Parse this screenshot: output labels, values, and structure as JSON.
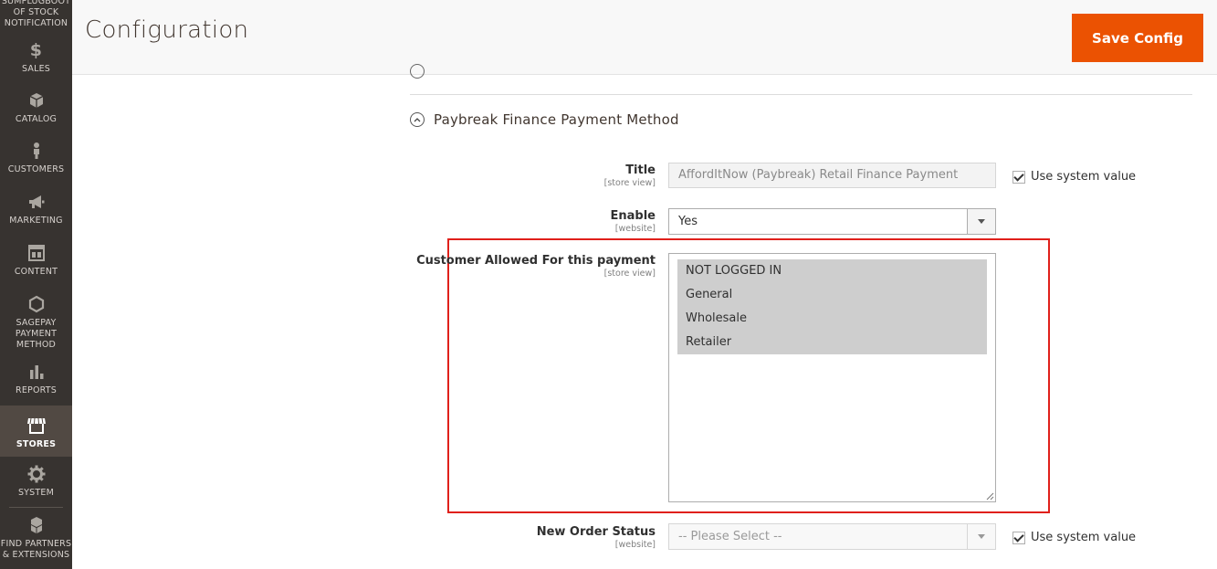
{
  "sidebar": {
    "items": [
      {
        "label": "SUMPLUGBOOT OF STOCK NOTIFICATION",
        "icon": "partial-module-icon"
      },
      {
        "label": "SALES",
        "icon": "dollar-icon"
      },
      {
        "label": "CATALOG",
        "icon": "box-icon"
      },
      {
        "label": "CUSTOMERS",
        "icon": "person-icon"
      },
      {
        "label": "MARKETING",
        "icon": "megaphone-icon"
      },
      {
        "label": "CONTENT",
        "icon": "layout-icon"
      },
      {
        "label": "SAGEPAY PAYMENT METHOD",
        "icon": "hexagon-icon"
      },
      {
        "label": "REPORTS",
        "icon": "bar-chart-icon"
      },
      {
        "label": "STORES",
        "icon": "storefront-icon"
      },
      {
        "label": "SYSTEM",
        "icon": "gear-icon"
      },
      {
        "label": "FIND PARTNERS & EXTENSIONS",
        "icon": "cubes-icon"
      }
    ],
    "top_partial_lines": [
      "SUMPLUGBOOT",
      "OF STOCK",
      "NOTIFICATION"
    ],
    "sagepay_lines": [
      "SAGEPAY",
      "PAYMENT",
      "METHOD"
    ],
    "partners_lines": [
      "FIND PARTNERS",
      "& EXTENSIONS"
    ]
  },
  "header": {
    "title": "Configuration",
    "save_label": "Save Config"
  },
  "section": {
    "title": "Paybreak Finance Payment Method"
  },
  "fields": {
    "title": {
      "label": "Title",
      "scope": "[store view]",
      "value": "AffordItNow (Paybreak) Retail Finance Payment",
      "use_system_label": "Use system value"
    },
    "enable": {
      "label": "Enable",
      "scope": "[website]",
      "value": "Yes"
    },
    "customer_allowed": {
      "label": "Customer Allowed For this payment",
      "scope": "[store view]",
      "options": [
        "NOT LOGGED IN",
        "General",
        "Wholesale",
        "Retailer"
      ]
    },
    "new_order_status": {
      "label": "New Order Status",
      "scope": "[website]",
      "value": "-- Please Select --",
      "use_system_label": "Use system value"
    }
  },
  "colors": {
    "accent": "#eb5202",
    "sidebar_bg": "#373330",
    "highlight": "#e0201b"
  }
}
